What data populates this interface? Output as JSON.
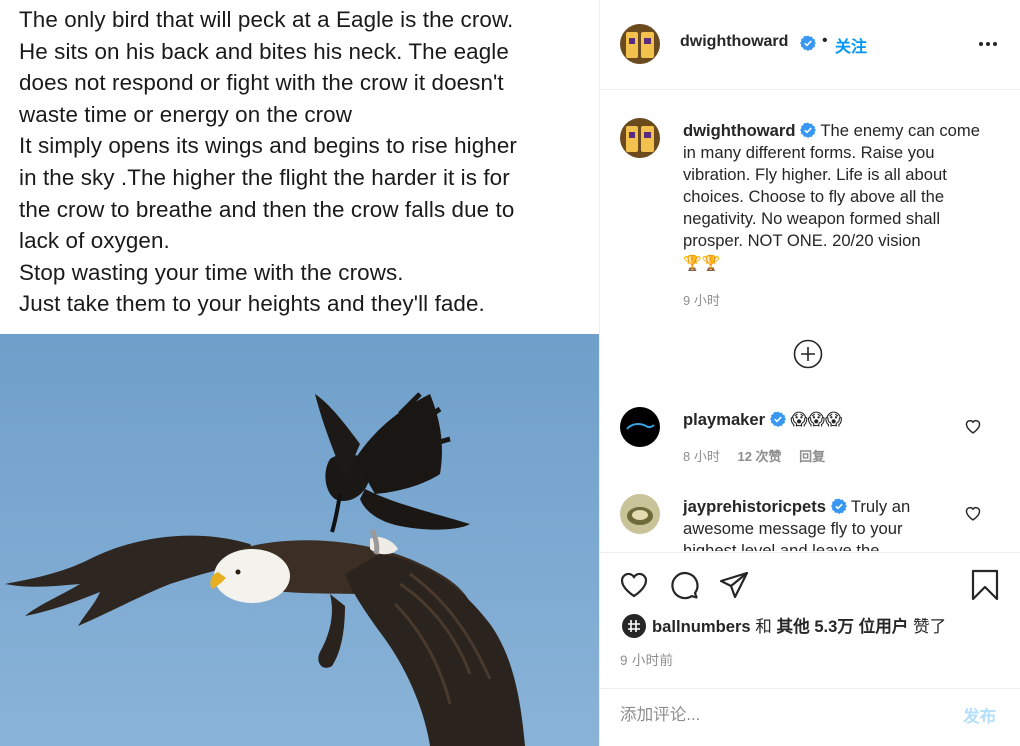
{
  "post_image": {
    "text_lines": [
      "The only bird that will peck at a Eagle is the crow.",
      "He sits on his back and bites his neck. The eagle",
      "does not respond or fight with the crow it doesn't",
      "waste time or energy on the crow",
      "It simply opens its wings and begins to rise higher",
      "in the sky .The higher the flight the harder it is for",
      "the crow to breathe and then the crow falls due to",
      "lack of oxygen.",
      "Stop wasting your time with the crows.",
      "Just take them to your heights and they'll fade."
    ]
  },
  "header": {
    "username": "dwighthoward",
    "dot": "•",
    "follow_label": "关注"
  },
  "caption": {
    "username": "dwighthoward",
    "text": "The enemy can come in many different forms. Raise you vibration. Fly higher. Life is all about choices. Choose to fly above all the negativity. No weapon formed shall prosper. NOT ONE. 20/20 vision",
    "emoji": "🏆🏆",
    "time": "9 小时"
  },
  "comments": [
    {
      "username": "playmaker",
      "text": "😱😱😱",
      "time": "8 小时",
      "likes": "12 次赞",
      "reply": "回复"
    },
    {
      "username": "jayprehistoricpets",
      "text": "Truly an awesome message fly to your highest level and leave the",
      "time": "",
      "likes": "",
      "reply": ""
    }
  ],
  "likes": {
    "user": "ballnumbers",
    "and": "和",
    "others": "其他",
    "count": "5.3万",
    "unit": "位用户",
    "suffix": "赞了"
  },
  "post_time": "9 小时前",
  "add_comment": {
    "placeholder": "添加评论...",
    "post_label": "发布"
  },
  "colors": {
    "accent": "#0095f6",
    "post_disabled": "#b2dffc",
    "verified": "#3897f0",
    "muted": "#8e8e8e",
    "sky": "#6a9fc9"
  },
  "icons": [
    "more-options-icon",
    "load-more-icon",
    "heart-icon",
    "comment-icon",
    "share-icon",
    "bookmark-icon",
    "verified-badge-icon"
  ]
}
